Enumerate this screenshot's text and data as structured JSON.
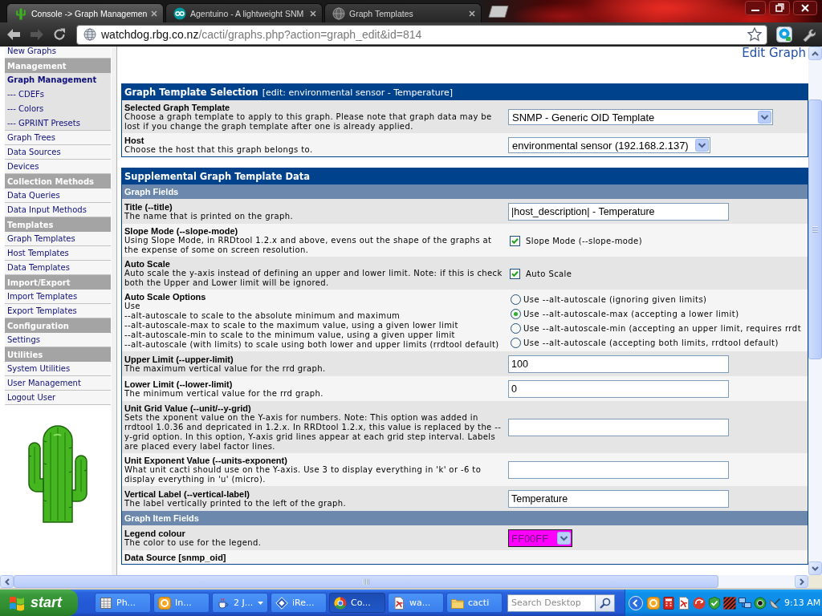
{
  "browser": {
    "tabs": [
      {
        "title": "Console -> Graph Managemen",
        "selected": true
      },
      {
        "title": "Agentuino - A lightweight SNM",
        "selected": false
      },
      {
        "title": "Graph Templates",
        "selected": false
      }
    ],
    "address": {
      "host": "watchdog.rbg.co.nz",
      "path": "/cacti/graphs.php?action=graph_edit&id=814"
    }
  },
  "sidebar": {
    "sections": [
      {
        "items": [
          {
            "label": "New Graphs",
            "selected": false
          }
        ]
      },
      {
        "header": "Management",
        "items": [
          {
            "label": "Graph Management",
            "selected": true,
            "children": [
              {
                "label": "--- CDEFs",
                "selected": false
              },
              {
                "label": "--- Colors",
                "selected": false
              },
              {
                "label": "--- GPRINT Presets",
                "selected": false
              }
            ]
          },
          {
            "label": "Graph Trees",
            "selected": false
          },
          {
            "label": "Data Sources",
            "selected": false
          },
          {
            "label": "Devices",
            "selected": false
          }
        ]
      },
      {
        "header": "Collection Methods",
        "items": [
          {
            "label": "Data Queries",
            "selected": false
          },
          {
            "label": "Data Input Methods",
            "selected": false
          }
        ]
      },
      {
        "header": "Templates",
        "items": [
          {
            "label": "Graph Templates",
            "selected": false
          },
          {
            "label": "Host Templates",
            "selected": false
          },
          {
            "label": "Data Templates",
            "selected": false
          }
        ]
      },
      {
        "header": "Import/Export",
        "items": [
          {
            "label": "Import Templates",
            "selected": false
          },
          {
            "label": "Export Templates",
            "selected": false
          }
        ]
      },
      {
        "header": "Configuration",
        "items": [
          {
            "label": "Settings",
            "selected": false
          }
        ]
      },
      {
        "header": "Utilities",
        "items": [
          {
            "label": "System Utilities",
            "selected": false
          },
          {
            "label": "User Management",
            "selected": false
          },
          {
            "label": "Logout User",
            "selected": false
          }
        ]
      }
    ]
  },
  "content": {
    "top_link": "Edit Graph",
    "panels": [
      {
        "title": "Graph Template Selection",
        "note": "[edit: environmental sensor - Temperature]",
        "rows": [
          {
            "kind": "field",
            "label": "Selected Graph Template",
            "description": "Choose a graph template to apply to this graph. Please note that graph data may be lost if you change the graph template after one is already applied.",
            "control": {
              "kind": "select",
              "value": "SNMP - Generic OID Template"
            }
          },
          {
            "kind": "field",
            "label": "Host",
            "description": "Choose the host that this graph belongs to.",
            "control": {
              "kind": "select",
              "value": "environmental sensor (192.168.2.137)"
            }
          }
        ]
      },
      {
        "title": "Supplemental Graph Template Data",
        "rows": [
          {
            "kind": "section",
            "label": "Graph Fields"
          },
          {
            "kind": "field",
            "label": "Title (--title)",
            "description": "The name that is printed on the graph.",
            "control": {
              "kind": "text",
              "value": "|host_description| - Temperature"
            }
          },
          {
            "kind": "field",
            "label": "Slope Mode (--slope-mode)",
            "description": "Using Slope Mode, in RRDtool 1.2.x and above, evens out the shape of the graphs at the expense of some on screen resolution.",
            "control": {
              "kind": "checkbox",
              "label": "Slope Mode (--slope-mode)",
              "checked": true
            }
          },
          {
            "kind": "field",
            "label": "Auto Scale",
            "description": "Auto scale the y-axis instead of defining an upper and lower limit. Note: if this is check both the Upper and Lower limit will be ignored.",
            "control": {
              "kind": "checkbox",
              "label": "Auto Scale",
              "checked": true
            }
          },
          {
            "kind": "field",
            "label": "Auto Scale Options",
            "description": "Use\n--alt-autoscale to scale to the absolute minimum and maximum\n--alt-autoscale-max to scale to the maximum value, using a given lower limit\n--alt-autoscale-min to scale to the minimum value, using a given upper limit\n--alt-autoscale (with limits) to scale using both lower and upper limits (rrdtool default)",
            "control": {
              "kind": "radio",
              "options": [
                {
                  "label": "Use --alt-autoscale (ignoring given limits)",
                  "selected": false
                },
                {
                  "label": "Use --alt-autoscale-max (accepting a lower limit)",
                  "selected": true
                },
                {
                  "label": "Use --alt-autoscale-min (accepting an upper limit, requires rrdt",
                  "selected": false
                },
                {
                  "label": "Use --alt-autoscale (accepting both limits, rrdtool default)",
                  "selected": false
                }
              ]
            }
          },
          {
            "kind": "field",
            "label": "Upper Limit (--upper-limit)",
            "description": "The maximum vertical value for the rrd graph.",
            "control": {
              "kind": "text",
              "value": "100"
            }
          },
          {
            "kind": "field",
            "label": "Lower Limit (--lower-limit)",
            "description": "The minimum vertical value for the rrd graph.",
            "control": {
              "kind": "text",
              "value": "0"
            }
          },
          {
            "kind": "field",
            "label": "Unit Grid Value (--unit/--y-grid)",
            "description": "Sets the xponent value on the Y-axis for numbers. Note: This option was added in rrdtool 1.0.36 and depricated in 1.2.x. In RRDtool 1.2.x, this value is replaced by the --y-grid option. In this option, Y-axis grid lines appear at each grid step interval. Labels are placed every label factor lines.",
            "control": {
              "kind": "text"
            }
          },
          {
            "kind": "field",
            "label": "Unit Exponent Value (--units-exponent)",
            "description": "What unit cacti should use on the Y-axis. Use 3 to display everything in 'k' or -6 to display everything in 'u' (micro).",
            "control": {
              "kind": "text"
            }
          },
          {
            "kind": "field",
            "label": "Vertical Label (--vertical-label)",
            "description": "The label vertically printed to the left of the graph.",
            "control": {
              "kind": "text",
              "value": "Temperature"
            }
          },
          {
            "kind": "section",
            "label": "Graph Item Fields"
          },
          {
            "kind": "field",
            "label": "Legend colour",
            "description": "The color to use for the legend.",
            "control": {
              "kind": "color",
              "value": "FF00FF",
              "color": "#ff00ff"
            }
          },
          {
            "kind": "field",
            "label": "Data Source [snmp_oid]"
          }
        ]
      }
    ]
  },
  "taskbar": {
    "start": "start",
    "tasks": [
      {
        "kind": "window",
        "label": "Ph...",
        "selected": false
      },
      {
        "kind": "window",
        "label": "In...",
        "selected": false
      },
      {
        "kind": "group",
        "label": "2 J...",
        "selected": false
      },
      {
        "kind": "window",
        "label": "iRe...",
        "selected": false
      },
      {
        "kind": "window",
        "label": "Co...",
        "selected": true
      },
      {
        "kind": "window",
        "label": "wa...",
        "selected": false
      },
      {
        "kind": "window",
        "label": "cacti",
        "selected": false
      }
    ],
    "search": {
      "placeholder": "Search Desktop"
    },
    "clock": "9:13 AM"
  }
}
